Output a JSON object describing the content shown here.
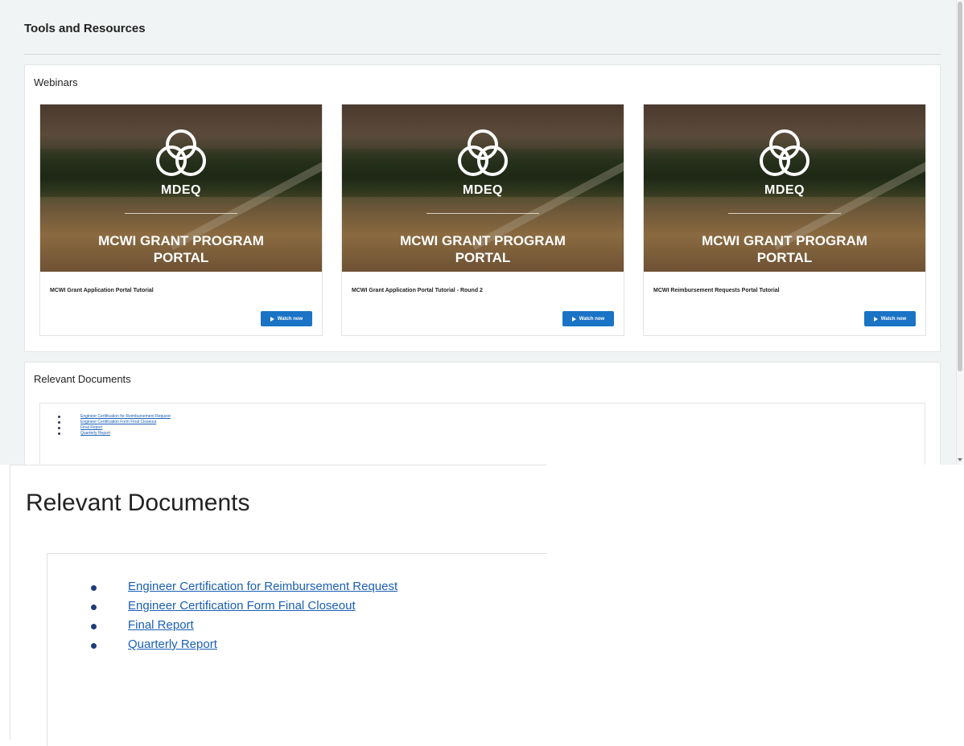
{
  "page": {
    "title": "Tools and Resources"
  },
  "webinars": {
    "title": "Webinars",
    "cards": [
      {
        "logo_text": "MDEQ",
        "caption_line1": "MCWI GRANT PROGRAM",
        "caption_line2": "PORTAL",
        "label": "MCWI Grant Application Portal Tutorial",
        "button": "Watch now"
      },
      {
        "logo_text": "MDEQ",
        "caption_line1": "MCWI GRANT PROGRAM",
        "caption_line2": "PORTAL",
        "label": "MCWI Grant Application Portal Tutorial - Round 2",
        "button": "Watch now"
      },
      {
        "logo_text": "MDEQ",
        "caption_line1": "MCWI GRANT PROGRAM",
        "caption_line2": "PORTAL",
        "label": "MCWI Reimbursement Requests Portal Tutorial",
        "button": "Watch now"
      }
    ]
  },
  "documents": {
    "title": "Relevant Documents",
    "items": [
      "Engineer Certification for Reimbursement Request",
      "Engineer Certification Form Final Closeout",
      "Final Report",
      "Quarterly Report"
    ]
  },
  "colors": {
    "accent": "#1a73c4",
    "link": "#1a5fb4",
    "page_bg": "#f1f4f4"
  }
}
